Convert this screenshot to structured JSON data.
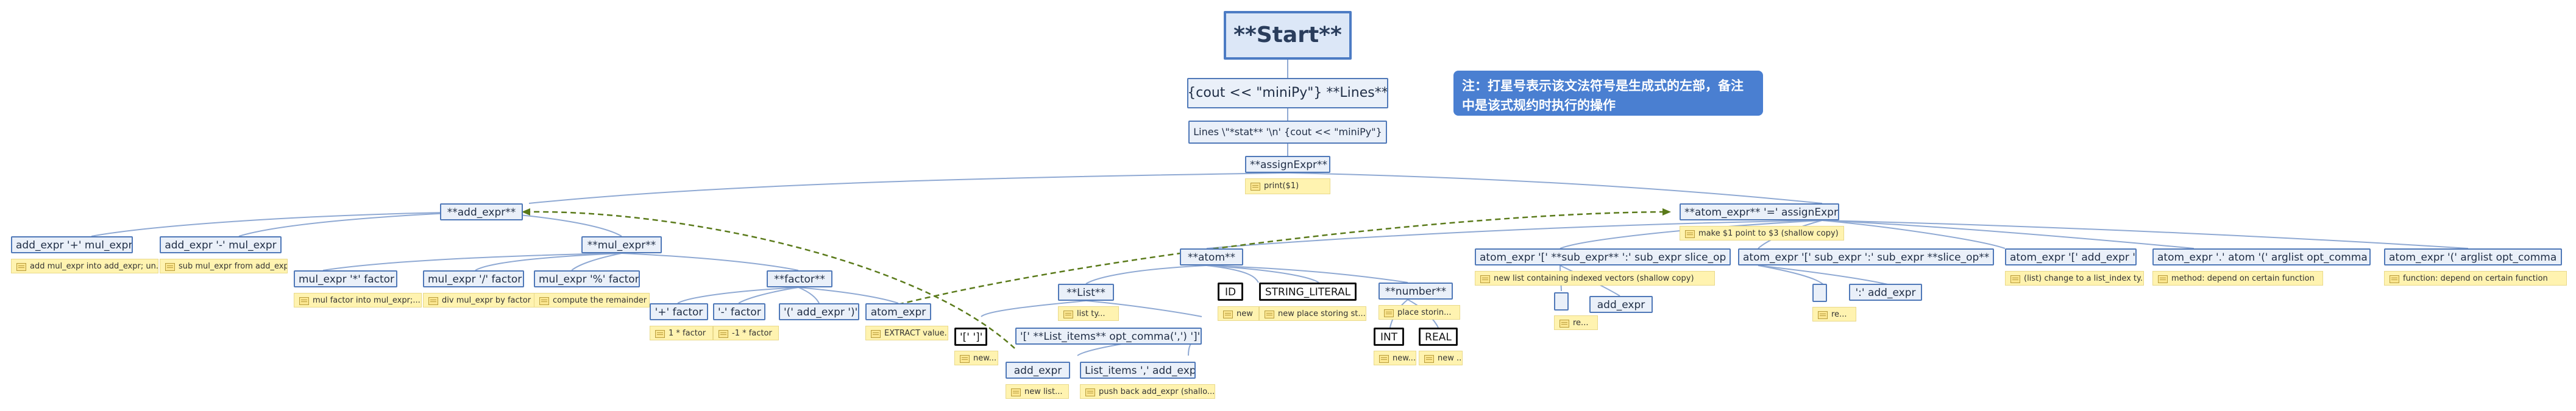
{
  "nodes": {
    "start": "**Start**",
    "cout_lines": "{cout << \"miniPy\"} **Lines**",
    "lines": "Lines \\\"*stat** '\\n' {cout << \"miniPy\"}",
    "assign": "**assignExpr**",
    "add": "**add_expr**",
    "atom_expr": "**atom_expr** '=' assignExpr",
    "add_plus": "add_expr '+' mul_expr",
    "add_minus": "add_expr '-' mul_expr",
    "mul": "**mul_expr**",
    "mul_times": "mul_expr '*' factor",
    "mul_div": "mul_expr '/' factor",
    "mul_mod": "mul_expr '%' factor",
    "factor": "**factor**",
    "f_plus": "'+' factor",
    "f_minus": "'-' factor",
    "f_paren": "'(' add_expr ')'",
    "f_atom": "atom_expr",
    "atom": "**atom**",
    "list": "**List**",
    "id": "ID",
    "string": "STRING_LITERAL",
    "number": "**number**",
    "int": "INT",
    "real": "REAL",
    "brackets": "'[' ']'",
    "list_items_br": "'[' **List_items** opt_comma(',') ']'",
    "le_add": "add_expr",
    "li_comma": "List_items ',' add_expr",
    "ae1": "atom_expr '[' **sub_expr** ':' sub_expr slice_op ']'",
    "ae2": "atom_expr '[' sub_expr ':' sub_expr **slice_op** ']'",
    "ae3": "atom_expr '[' add_expr ']'",
    "ae4": "atom_expr '.' atom '(' arglist opt_comma ')'",
    "ae5": "atom_expr '(' arglist opt_comma ')'",
    "sub_add": "add_expr",
    "slice_add": "':' add_expr"
  },
  "notes": {
    "print": "print($1)",
    "make": "make $1 point to $3 (shallow copy)",
    "add_plus": "add mul_expr into add_expr; un...",
    "add_minus": "sub mul_expr from add_expr",
    "mul_times": "mul factor into mul_expr;...",
    "mul_div": "div mul_expr by factor",
    "mul_mod": "compute the remainder",
    "f_plus": "1 * factor",
    "f_minus": "-1 * factor",
    "f_atom": "EXTRACT value...",
    "list": "list ty...",
    "id": "new",
    "string": "new place storing st...",
    "number": "place storin...",
    "int": "new...",
    "real": "new ...",
    "brackets": "new...",
    "le_add": "new list...",
    "li_comma": "push back add_expr (shallo...",
    "ae1": "new list containing indexed vectors (shallow copy)",
    "ae3": "(list) change to a list_index ty...",
    "ae4": "method: depend on certain function",
    "ae5": "function: depend on certain function",
    "sub_blank": "re...",
    "slice_blank": "re..."
  },
  "callout": {
    "line1": "注：打星号表示该文法符号是生成式的左部，备注",
    "line2": "中是该式规约时执行的操作"
  },
  "colors": {
    "node_fill": "#eaf0f9",
    "node_border": "#4f78b8",
    "note_fill": "#fff3b0",
    "edge": "#8fa9d3",
    "dashed_edge": "#5a7a1a",
    "callout": "#4a7fd1"
  }
}
